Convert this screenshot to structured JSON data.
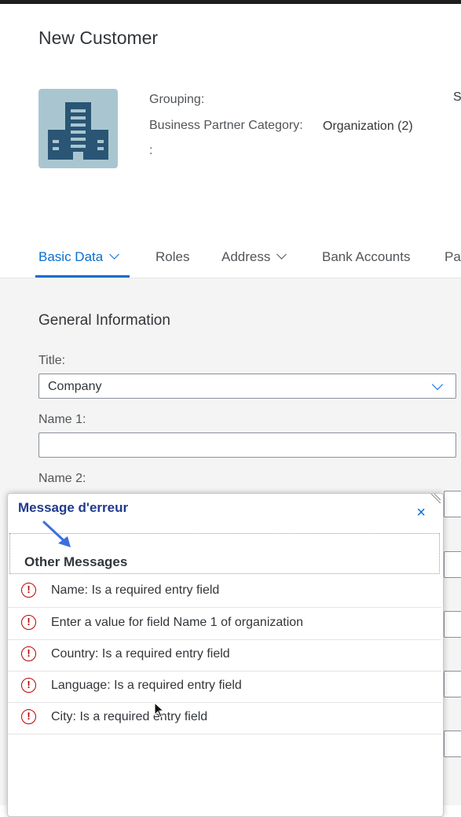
{
  "page": {
    "title": "New Customer"
  },
  "header": {
    "grouping_label": "Grouping:",
    "category_label": "Business Partner Category:",
    "category_value": "Organization (2)",
    "extra_label": ":",
    "right_fragment": "S",
    "avatar_icon": "building-icon",
    "avatar_color": "#a9c6d0"
  },
  "tabs": [
    {
      "label": "Basic Data",
      "selected": true,
      "has_menu": true
    },
    {
      "label": "Roles",
      "selected": false,
      "has_menu": false
    },
    {
      "label": "Address",
      "selected": false,
      "has_menu": true
    },
    {
      "label": "Bank Accounts",
      "selected": false,
      "has_menu": false
    },
    {
      "label": "Pa",
      "selected": false,
      "has_menu": false
    }
  ],
  "form": {
    "section_title": "General Information",
    "title_label": "Title:",
    "title_value": "Company",
    "name1_label": "Name 1:",
    "name1_value": "",
    "name2_label": "Name 2:"
  },
  "popover": {
    "group_header": "Other Messages",
    "close_icon": "close-icon",
    "messages": [
      {
        "text": "Name: Is a required entry field",
        "type": "error"
      },
      {
        "text": "Enter a value for field Name 1 of organization",
        "type": "error"
      },
      {
        "text": "Country: Is a required entry field",
        "type": "error"
      },
      {
        "text": "Language: Is a required entry field",
        "type": "error"
      },
      {
        "text": "City: Is a required entry field",
        "type": "error"
      }
    ]
  },
  "annotation": {
    "text": "Message d'erreur",
    "color": "#1f3a8f"
  },
  "colors": {
    "accent": "#0a6ed1",
    "error": "#bb0000",
    "background": "#f4f4f4"
  }
}
